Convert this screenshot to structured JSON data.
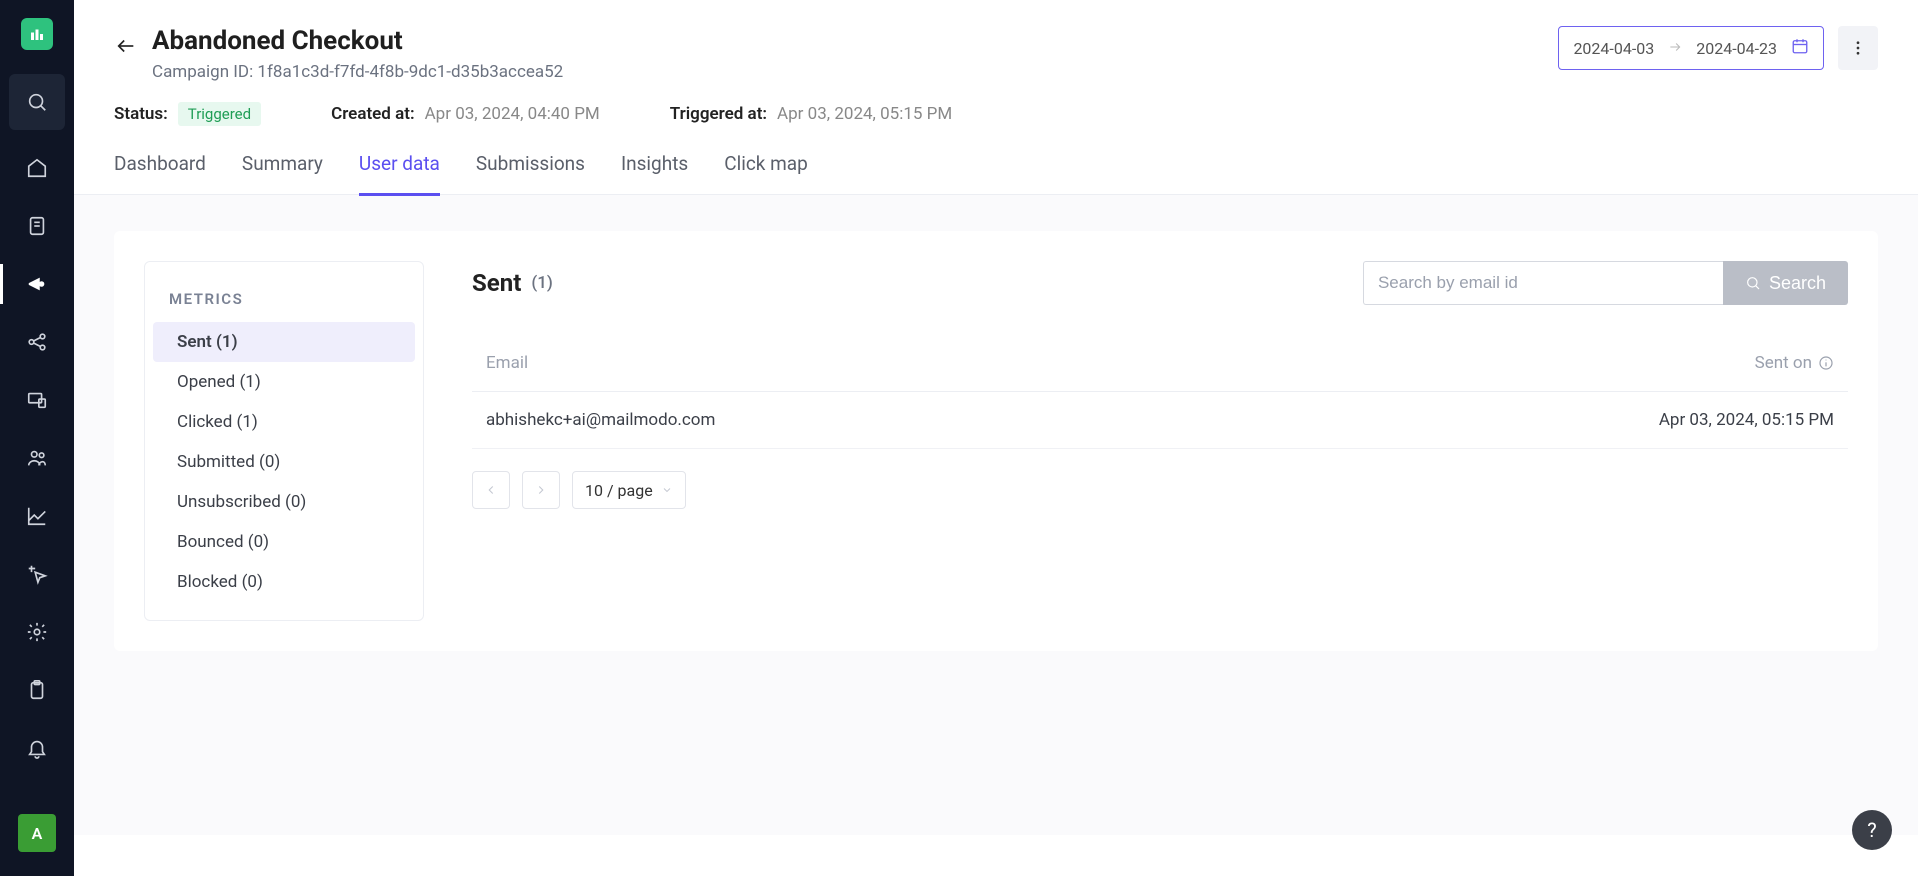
{
  "sidebar": {
    "avatar_initial": "A"
  },
  "header": {
    "title": "Abandoned Checkout",
    "campaign_id_label": "Campaign ID:",
    "campaign_id": "1f8a1c3d-f7fd-4f8b-9dc1-d35b3accea52",
    "date_range": {
      "start": "2024-04-03",
      "end": "2024-04-23"
    }
  },
  "status": {
    "status_label": "Status:",
    "status_value": "Triggered",
    "created_label": "Created at:",
    "created_value": "Apr 03, 2024, 04:40 PM",
    "triggered_label": "Triggered at:",
    "triggered_value": "Apr 03, 2024, 05:15 PM"
  },
  "tabs": {
    "dashboard": "Dashboard",
    "summary": "Summary",
    "user_data": "User data",
    "submissions": "Submissions",
    "insights": "Insights",
    "click_map": "Click map"
  },
  "metrics": {
    "heading": "METRICS",
    "items": [
      {
        "label": "Sent (1)"
      },
      {
        "label": "Opened (1)"
      },
      {
        "label": "Clicked (1)"
      },
      {
        "label": "Submitted (0)"
      },
      {
        "label": "Unsubscribed (0)"
      },
      {
        "label": "Bounced (0)"
      },
      {
        "label": "Blocked (0)"
      }
    ]
  },
  "sent": {
    "title": "Sent",
    "count": "(1)",
    "search_placeholder": "Search by email id",
    "search_button": "Search"
  },
  "table": {
    "cols": {
      "email": "Email",
      "sent_on": "Sent on"
    },
    "rows": [
      {
        "email": "abhishekc+ai@mailmodo.com",
        "sent_on": "Apr 03, 2024, 05:15 PM"
      }
    ]
  },
  "pagination": {
    "page_size_label": "10 / page"
  },
  "help": {
    "label": "?"
  }
}
